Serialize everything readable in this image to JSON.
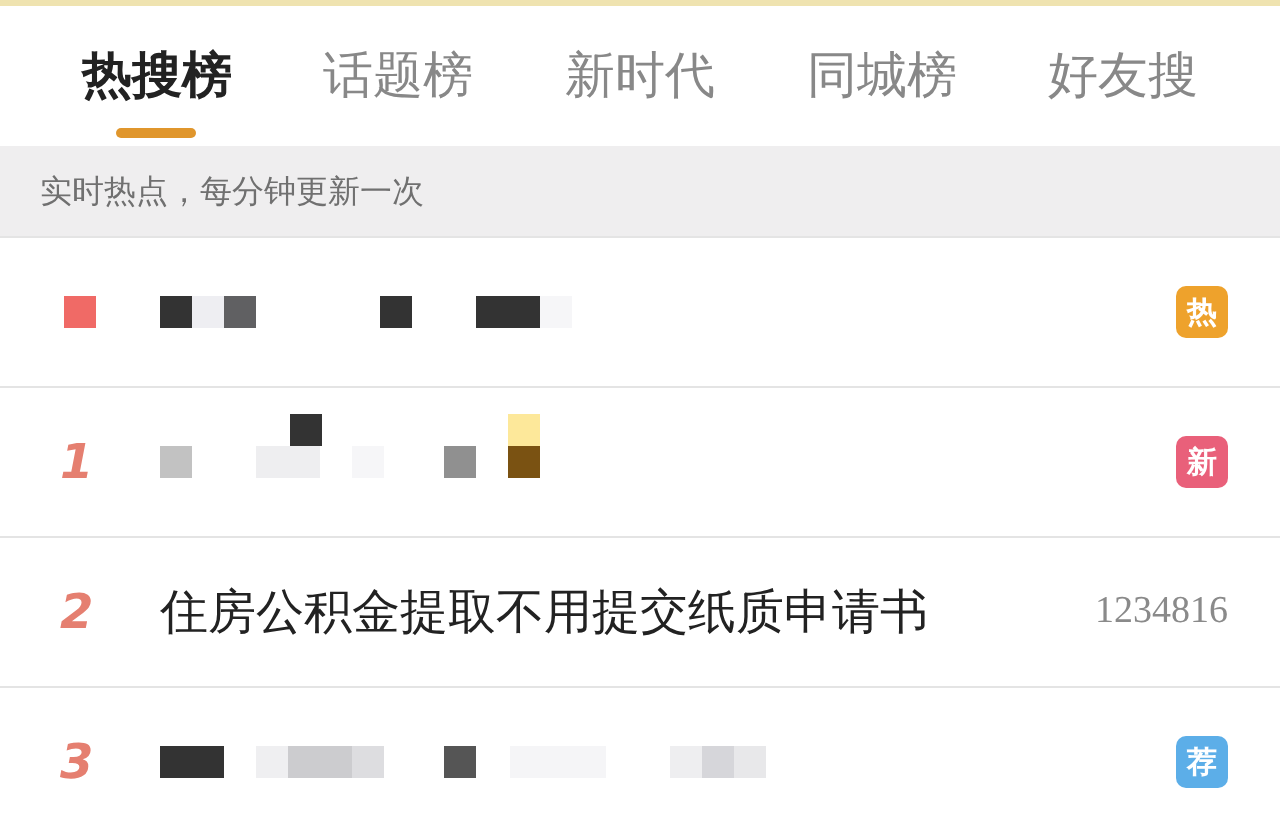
{
  "tabs": [
    {
      "label": "热搜榜",
      "selected": true
    },
    {
      "label": "话题榜",
      "selected": false
    },
    {
      "label": "新时代",
      "selected": false
    },
    {
      "label": "同城榜",
      "selected": false
    },
    {
      "label": "好友搜",
      "selected": false
    }
  ],
  "subheader": "实时热点，每分钟更新一次",
  "rows": [
    {
      "rank": {
        "kind": "pinned"
      },
      "title": {
        "kind": "mosaic"
      },
      "badge": {
        "label": "热",
        "color": "#eea22c"
      }
    },
    {
      "rank": {
        "kind": "number",
        "text": "1"
      },
      "title": {
        "kind": "mosaic"
      },
      "badge": {
        "label": "新",
        "color": "#e9607a"
      }
    },
    {
      "rank": {
        "kind": "number",
        "text": "2"
      },
      "title": {
        "kind": "text",
        "text": "住房公积金提取不用提交纸质申请书"
      },
      "count": "1234816"
    },
    {
      "rank": {
        "kind": "number",
        "text": "3"
      },
      "title": {
        "kind": "mosaic"
      },
      "badge": {
        "label": "荐",
        "color": "#5caee8"
      }
    }
  ]
}
